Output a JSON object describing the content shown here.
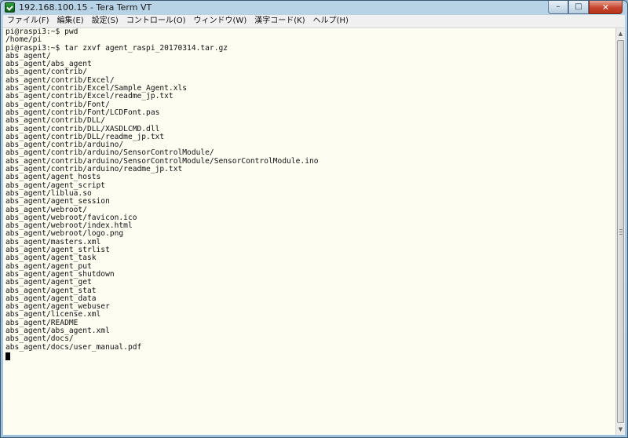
{
  "window": {
    "title": "192.168.100.15 - Tera Term VT",
    "app_icon": "tera-term-icon",
    "buttons": {
      "minimize": "–",
      "maximize": "□",
      "close": "✕"
    }
  },
  "menu": [
    {
      "label": "ファイル(F)"
    },
    {
      "label": "編集(E)"
    },
    {
      "label": "設定(S)"
    },
    {
      "label": "コントロール(O)"
    },
    {
      "label": "ウィンドウ(W)"
    },
    {
      "label": "漢字コード(K)"
    },
    {
      "label": "ヘルプ(H)"
    }
  ],
  "terminal": {
    "lines": [
      "pi@raspi3:~$ pwd",
      "/home/pi",
      "pi@raspi3:~$ tar zxvf agent_raspi_20170314.tar.gz",
      "abs_agent/",
      "abs_agent/abs_agent",
      "abs_agent/contrib/",
      "abs_agent/contrib/Excel/",
      "abs_agent/contrib/Excel/Sample_Agent.xls",
      "abs_agent/contrib/Excel/readme_jp.txt",
      "abs_agent/contrib/Font/",
      "abs_agent/contrib/Font/LCDFont.pas",
      "abs_agent/contrib/DLL/",
      "abs_agent/contrib/DLL/XASDLCMD.dll",
      "abs_agent/contrib/DLL/readme_jp.txt",
      "abs_agent/contrib/arduino/",
      "abs_agent/contrib/arduino/SensorControlModule/",
      "abs_agent/contrib/arduino/SensorControlModule/SensorControlModule.ino",
      "abs_agent/contrib/arduino/readme_jp.txt",
      "abs_agent/agent_hosts",
      "abs_agent/agent_script",
      "abs_agent/liblua.so",
      "abs_agent/agent_session",
      "abs_agent/webroot/",
      "abs_agent/webroot/favicon.ico",
      "abs_agent/webroot/index.html",
      "abs_agent/webroot/logo.png",
      "abs_agent/masters.xml",
      "abs_agent/agent_strlist",
      "abs_agent/agent_task",
      "abs_agent/agent_put",
      "abs_agent/agent_shutdown",
      "abs_agent/agent_get",
      "abs_agent/agent_stat",
      "abs_agent/agent_data",
      "abs_agent/agent_webuser",
      "abs_agent/license.xml",
      "abs_agent/README",
      "abs_agent/abs_agent.xml",
      "abs_agent/docs/",
      "abs_agent/docs/user_manual.pdf"
    ]
  },
  "colors": {
    "terminal_bg": "#fdfdf2",
    "terminal_fg": "#111111",
    "titlebar": "#b9d3e6",
    "close_button": "#c7452e"
  }
}
